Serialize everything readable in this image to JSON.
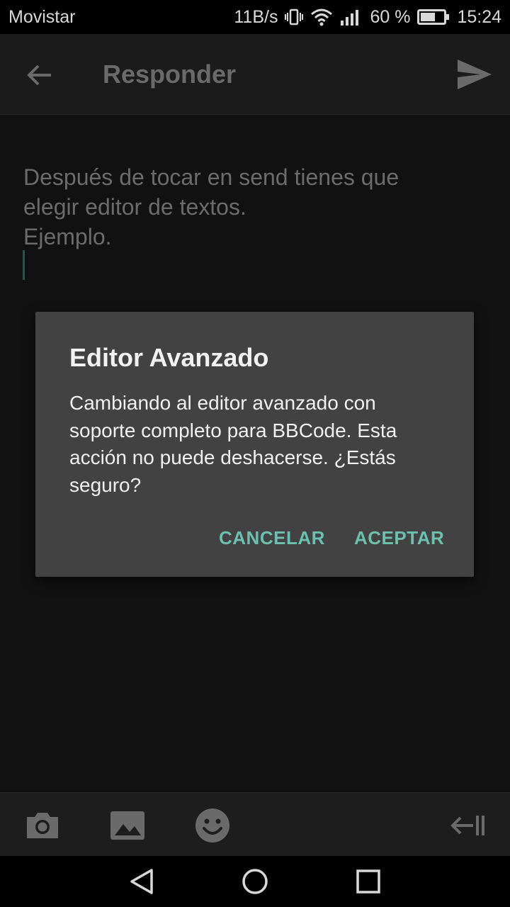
{
  "status_bar": {
    "carrier": "Movistar",
    "network_speed": "11B/s",
    "battery": "60 %",
    "time": "15:24"
  },
  "app_bar": {
    "title": "Responder"
  },
  "editor": {
    "lines": [
      "Después de tocar en send tienes que",
      "elegir editor de textos.",
      "Ejemplo."
    ]
  },
  "dialog": {
    "title": "Editor Avanzado",
    "message_lines": [
      "Cambiando al editor avanzado con",
      "soporte completo para BBCode. Esta",
      "acción no puede deshacerse. ¿Estás",
      "seguro?"
    ],
    "cancel_label": "CANCELAR",
    "accept_label": "ACEPTAR",
    "accent_color": "#6dbfae"
  },
  "toolbar": {
    "icons": [
      "camera-icon",
      "image-icon",
      "emoji-icon",
      "collapse-keyboard-icon"
    ]
  },
  "nav_bar": {
    "icons": [
      "back-triangle-icon",
      "home-circle-icon",
      "recents-square-icon"
    ]
  }
}
